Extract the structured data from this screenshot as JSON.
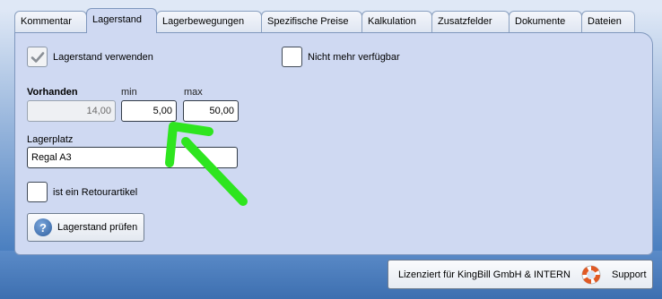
{
  "tabs": [
    {
      "label": "Kommentar",
      "active": false
    },
    {
      "label": "Lagerstand",
      "active": true
    },
    {
      "label": "Lagerbewegungen",
      "active": false
    },
    {
      "label": "Spezifische Preise",
      "active": false
    },
    {
      "label": "Kalkulation",
      "active": false
    },
    {
      "label": "Zusatzfelder",
      "active": false
    },
    {
      "label": "Dokumente",
      "active": false
    },
    {
      "label": "Dateien",
      "active": false
    }
  ],
  "lagerstand": {
    "use_stock": {
      "label": "Lagerstand verwenden",
      "checked": true
    },
    "not_available": {
      "label": "Nicht mehr verfügbar",
      "checked": false
    },
    "vorhanden_label": "Vorhanden",
    "vorhanden_value": "14,00",
    "min_label": "min",
    "min_value": "5,00",
    "max_label": "max",
    "max_value": "50,00",
    "lagerplatz_label": "Lagerplatz",
    "lagerplatz_value": "Regal A3",
    "retour": {
      "label": "ist ein Retourartikel",
      "checked": false
    },
    "check_button_label": "Lagerstand prüfen",
    "check_icon": "help-question-icon"
  },
  "status": {
    "license_text": "Lizenziert für KingBill GmbH & INTERN",
    "support_label": "Support",
    "support_icon": "lifebuoy-icon"
  },
  "annotation": {
    "arrow_color": "#2ee51f"
  },
  "colors": {
    "panel": "#cfd9f2",
    "frame_blue": "#3d6fb0",
    "tab_border": "#7f97bd"
  }
}
